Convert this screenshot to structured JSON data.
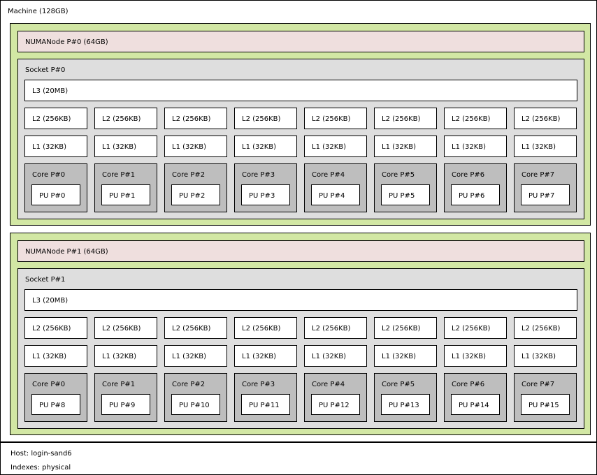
{
  "machine": {
    "label": "Machine (128GB)",
    "numa_nodes": [
      {
        "label": "NUMANode P#0 (64GB)",
        "socket": {
          "label": "Socket P#0",
          "l3": "L3 (20MB)",
          "l2": [
            "L2 (256KB)",
            "L2 (256KB)",
            "L2 (256KB)",
            "L2 (256KB)",
            "L2 (256KB)",
            "L2 (256KB)",
            "L2 (256KB)",
            "L2 (256KB)"
          ],
          "l1": [
            "L1 (32KB)",
            "L1 (32KB)",
            "L1 (32KB)",
            "L1 (32KB)",
            "L1 (32KB)",
            "L1 (32KB)",
            "L1 (32KB)",
            "L1 (32KB)"
          ],
          "cores": [
            {
              "label": "Core P#0",
              "pu": "PU P#0"
            },
            {
              "label": "Core P#1",
              "pu": "PU P#1"
            },
            {
              "label": "Core P#2",
              "pu": "PU P#2"
            },
            {
              "label": "Core P#3",
              "pu": "PU P#3"
            },
            {
              "label": "Core P#4",
              "pu": "PU P#4"
            },
            {
              "label": "Core P#5",
              "pu": "PU P#5"
            },
            {
              "label": "Core P#6",
              "pu": "PU P#6"
            },
            {
              "label": "Core P#7",
              "pu": "PU P#7"
            }
          ]
        }
      },
      {
        "label": "NUMANode P#1 (64GB)",
        "socket": {
          "label": "Socket P#1",
          "l3": "L3 (20MB)",
          "l2": [
            "L2 (256KB)",
            "L2 (256KB)",
            "L2 (256KB)",
            "L2 (256KB)",
            "L2 (256KB)",
            "L2 (256KB)",
            "L2 (256KB)",
            "L2 (256KB)"
          ],
          "l1": [
            "L1 (32KB)",
            "L1 (32KB)",
            "L1 (32KB)",
            "L1 (32KB)",
            "L1 (32KB)",
            "L1 (32KB)",
            "L1 (32KB)",
            "L1 (32KB)"
          ],
          "cores": [
            {
              "label": "Core P#0",
              "pu": "PU P#8"
            },
            {
              "label": "Core P#1",
              "pu": "PU P#9"
            },
            {
              "label": "Core P#2",
              "pu": "PU P#10"
            },
            {
              "label": "Core P#3",
              "pu": "PU P#11"
            },
            {
              "label": "Core P#4",
              "pu": "PU P#12"
            },
            {
              "label": "Core P#5",
              "pu": "PU P#13"
            },
            {
              "label": "Core P#6",
              "pu": "PU P#14"
            },
            {
              "label": "Core P#7",
              "pu": "PU P#15"
            }
          ]
        }
      }
    ]
  },
  "legend": {
    "host": "Host: login-sand6",
    "indexes": "Indexes: physical"
  },
  "colors": {
    "numa_group": "#d2e7a4",
    "numa_node": "#efdfde",
    "socket": "#dedede",
    "core": "#bebebe",
    "cache": "#ffffff",
    "accent_line": "#a76a6a"
  }
}
